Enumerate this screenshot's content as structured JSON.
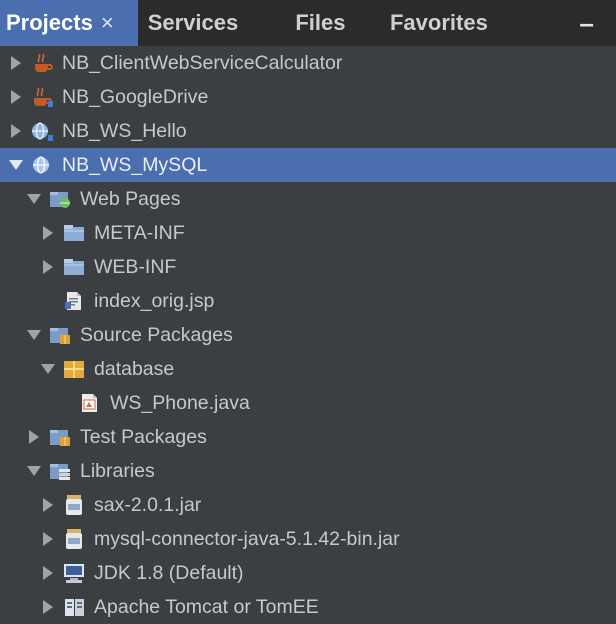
{
  "tabs": [
    {
      "label": "Projects",
      "active": true,
      "close": "×"
    },
    {
      "label": "Services",
      "active": false
    },
    {
      "label": "Files",
      "active": false
    },
    {
      "label": "Favorites",
      "active": false
    }
  ],
  "minimize_label": "–",
  "tree": [
    {
      "label": "NB_ClientWebServiceCalculator",
      "icon": "java-project-icon",
      "expanded": false
    },
    {
      "label": "NB_GoogleDrive",
      "icon": "java-project-icon",
      "expanded": false
    },
    {
      "label": "NB_WS_Hello",
      "icon": "web-project-icon",
      "expanded": false
    },
    {
      "label": "NB_WS_MySQL",
      "icon": "web-project-icon",
      "expanded": true,
      "selected": true
    },
    {
      "label": "Web Pages",
      "icon": "web-pages-folder-icon",
      "expanded": true
    },
    {
      "label": "META-INF",
      "icon": "folder-icon",
      "expanded": false
    },
    {
      "label": "WEB-INF",
      "icon": "folder-icon",
      "expanded": false
    },
    {
      "label": "index_orig.jsp",
      "icon": "jsp-file-icon"
    },
    {
      "label": "Source Packages",
      "icon": "source-packages-icon",
      "expanded": true
    },
    {
      "label": "database",
      "icon": "package-icon",
      "expanded": true
    },
    {
      "label": "WS_Phone.java",
      "icon": "java-class-icon"
    },
    {
      "label": "Test Packages",
      "icon": "test-packages-icon",
      "expanded": false
    },
    {
      "label": "Libraries",
      "icon": "libraries-icon",
      "expanded": true
    },
    {
      "label": "sax-2.0.1.jar",
      "icon": "jar-icon",
      "expanded": false
    },
    {
      "label": "mysql-connector-java-5.1.42-bin.jar",
      "icon": "jar-icon",
      "expanded": false
    },
    {
      "label": "JDK 1.8 (Default)",
      "icon": "jdk-icon",
      "expanded": false
    },
    {
      "label": "Apache Tomcat or TomEE",
      "icon": "server-library-icon",
      "expanded": false
    }
  ]
}
